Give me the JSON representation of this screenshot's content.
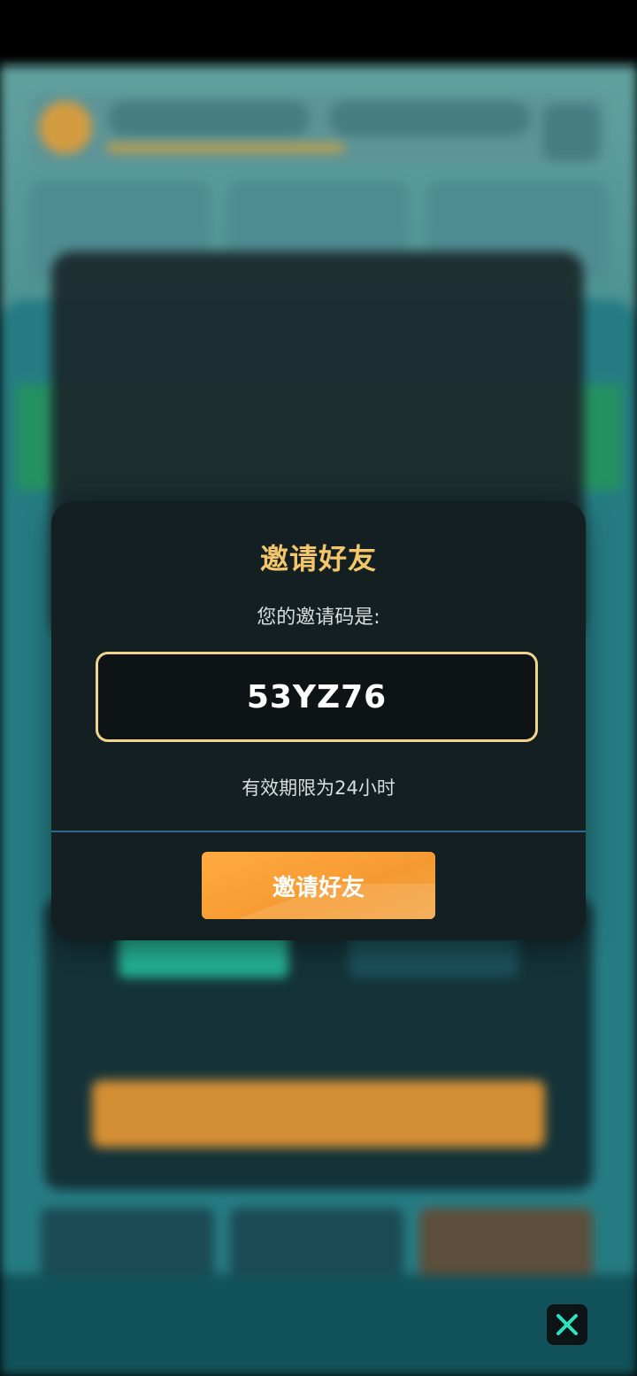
{
  "dialog": {
    "title": "邀请好友",
    "subtitle": "您的邀请码是:",
    "invite_code": "53YZ76",
    "expiry_note": "有效期限为24小时",
    "invite_button_label": "邀请好友"
  },
  "icons": {
    "close": "close-x-icon"
  },
  "colors": {
    "dialog_bg": "#141f22",
    "title": "#f4c66a",
    "code_border": "#f2d58c",
    "button": "#f59a32",
    "close_x": "#2fe2bf"
  }
}
